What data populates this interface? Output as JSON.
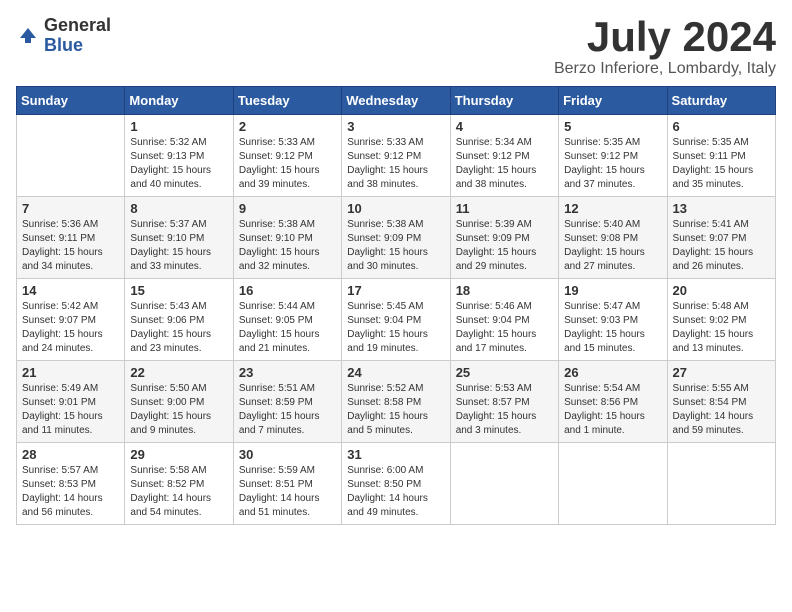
{
  "logo": {
    "general": "General",
    "blue": "Blue"
  },
  "title": "July 2024",
  "location": "Berzo Inferiore, Lombardy, Italy",
  "weekdays": [
    "Sunday",
    "Monday",
    "Tuesday",
    "Wednesday",
    "Thursday",
    "Friday",
    "Saturday"
  ],
  "weeks": [
    [
      {
        "day": "",
        "info": ""
      },
      {
        "day": "1",
        "info": "Sunrise: 5:32 AM\nSunset: 9:13 PM\nDaylight: 15 hours\nand 40 minutes."
      },
      {
        "day": "2",
        "info": "Sunrise: 5:33 AM\nSunset: 9:12 PM\nDaylight: 15 hours\nand 39 minutes."
      },
      {
        "day": "3",
        "info": "Sunrise: 5:33 AM\nSunset: 9:12 PM\nDaylight: 15 hours\nand 38 minutes."
      },
      {
        "day": "4",
        "info": "Sunrise: 5:34 AM\nSunset: 9:12 PM\nDaylight: 15 hours\nand 38 minutes."
      },
      {
        "day": "5",
        "info": "Sunrise: 5:35 AM\nSunset: 9:12 PM\nDaylight: 15 hours\nand 37 minutes."
      },
      {
        "day": "6",
        "info": "Sunrise: 5:35 AM\nSunset: 9:11 PM\nDaylight: 15 hours\nand 35 minutes."
      }
    ],
    [
      {
        "day": "7",
        "info": "Sunrise: 5:36 AM\nSunset: 9:11 PM\nDaylight: 15 hours\nand 34 minutes."
      },
      {
        "day": "8",
        "info": "Sunrise: 5:37 AM\nSunset: 9:10 PM\nDaylight: 15 hours\nand 33 minutes."
      },
      {
        "day": "9",
        "info": "Sunrise: 5:38 AM\nSunset: 9:10 PM\nDaylight: 15 hours\nand 32 minutes."
      },
      {
        "day": "10",
        "info": "Sunrise: 5:38 AM\nSunset: 9:09 PM\nDaylight: 15 hours\nand 30 minutes."
      },
      {
        "day": "11",
        "info": "Sunrise: 5:39 AM\nSunset: 9:09 PM\nDaylight: 15 hours\nand 29 minutes."
      },
      {
        "day": "12",
        "info": "Sunrise: 5:40 AM\nSunset: 9:08 PM\nDaylight: 15 hours\nand 27 minutes."
      },
      {
        "day": "13",
        "info": "Sunrise: 5:41 AM\nSunset: 9:07 PM\nDaylight: 15 hours\nand 26 minutes."
      }
    ],
    [
      {
        "day": "14",
        "info": "Sunrise: 5:42 AM\nSunset: 9:07 PM\nDaylight: 15 hours\nand 24 minutes."
      },
      {
        "day": "15",
        "info": "Sunrise: 5:43 AM\nSunset: 9:06 PM\nDaylight: 15 hours\nand 23 minutes."
      },
      {
        "day": "16",
        "info": "Sunrise: 5:44 AM\nSunset: 9:05 PM\nDaylight: 15 hours\nand 21 minutes."
      },
      {
        "day": "17",
        "info": "Sunrise: 5:45 AM\nSunset: 9:04 PM\nDaylight: 15 hours\nand 19 minutes."
      },
      {
        "day": "18",
        "info": "Sunrise: 5:46 AM\nSunset: 9:04 PM\nDaylight: 15 hours\nand 17 minutes."
      },
      {
        "day": "19",
        "info": "Sunrise: 5:47 AM\nSunset: 9:03 PM\nDaylight: 15 hours\nand 15 minutes."
      },
      {
        "day": "20",
        "info": "Sunrise: 5:48 AM\nSunset: 9:02 PM\nDaylight: 15 hours\nand 13 minutes."
      }
    ],
    [
      {
        "day": "21",
        "info": "Sunrise: 5:49 AM\nSunset: 9:01 PM\nDaylight: 15 hours\nand 11 minutes."
      },
      {
        "day": "22",
        "info": "Sunrise: 5:50 AM\nSunset: 9:00 PM\nDaylight: 15 hours\nand 9 minutes."
      },
      {
        "day": "23",
        "info": "Sunrise: 5:51 AM\nSunset: 8:59 PM\nDaylight: 15 hours\nand 7 minutes."
      },
      {
        "day": "24",
        "info": "Sunrise: 5:52 AM\nSunset: 8:58 PM\nDaylight: 15 hours\nand 5 minutes."
      },
      {
        "day": "25",
        "info": "Sunrise: 5:53 AM\nSunset: 8:57 PM\nDaylight: 15 hours\nand 3 minutes."
      },
      {
        "day": "26",
        "info": "Sunrise: 5:54 AM\nSunset: 8:56 PM\nDaylight: 15 hours\nand 1 minute."
      },
      {
        "day": "27",
        "info": "Sunrise: 5:55 AM\nSunset: 8:54 PM\nDaylight: 14 hours\nand 59 minutes."
      }
    ],
    [
      {
        "day": "28",
        "info": "Sunrise: 5:57 AM\nSunset: 8:53 PM\nDaylight: 14 hours\nand 56 minutes."
      },
      {
        "day": "29",
        "info": "Sunrise: 5:58 AM\nSunset: 8:52 PM\nDaylight: 14 hours\nand 54 minutes."
      },
      {
        "day": "30",
        "info": "Sunrise: 5:59 AM\nSunset: 8:51 PM\nDaylight: 14 hours\nand 51 minutes."
      },
      {
        "day": "31",
        "info": "Sunrise: 6:00 AM\nSunset: 8:50 PM\nDaylight: 14 hours\nand 49 minutes."
      },
      {
        "day": "",
        "info": ""
      },
      {
        "day": "",
        "info": ""
      },
      {
        "day": "",
        "info": ""
      }
    ]
  ]
}
